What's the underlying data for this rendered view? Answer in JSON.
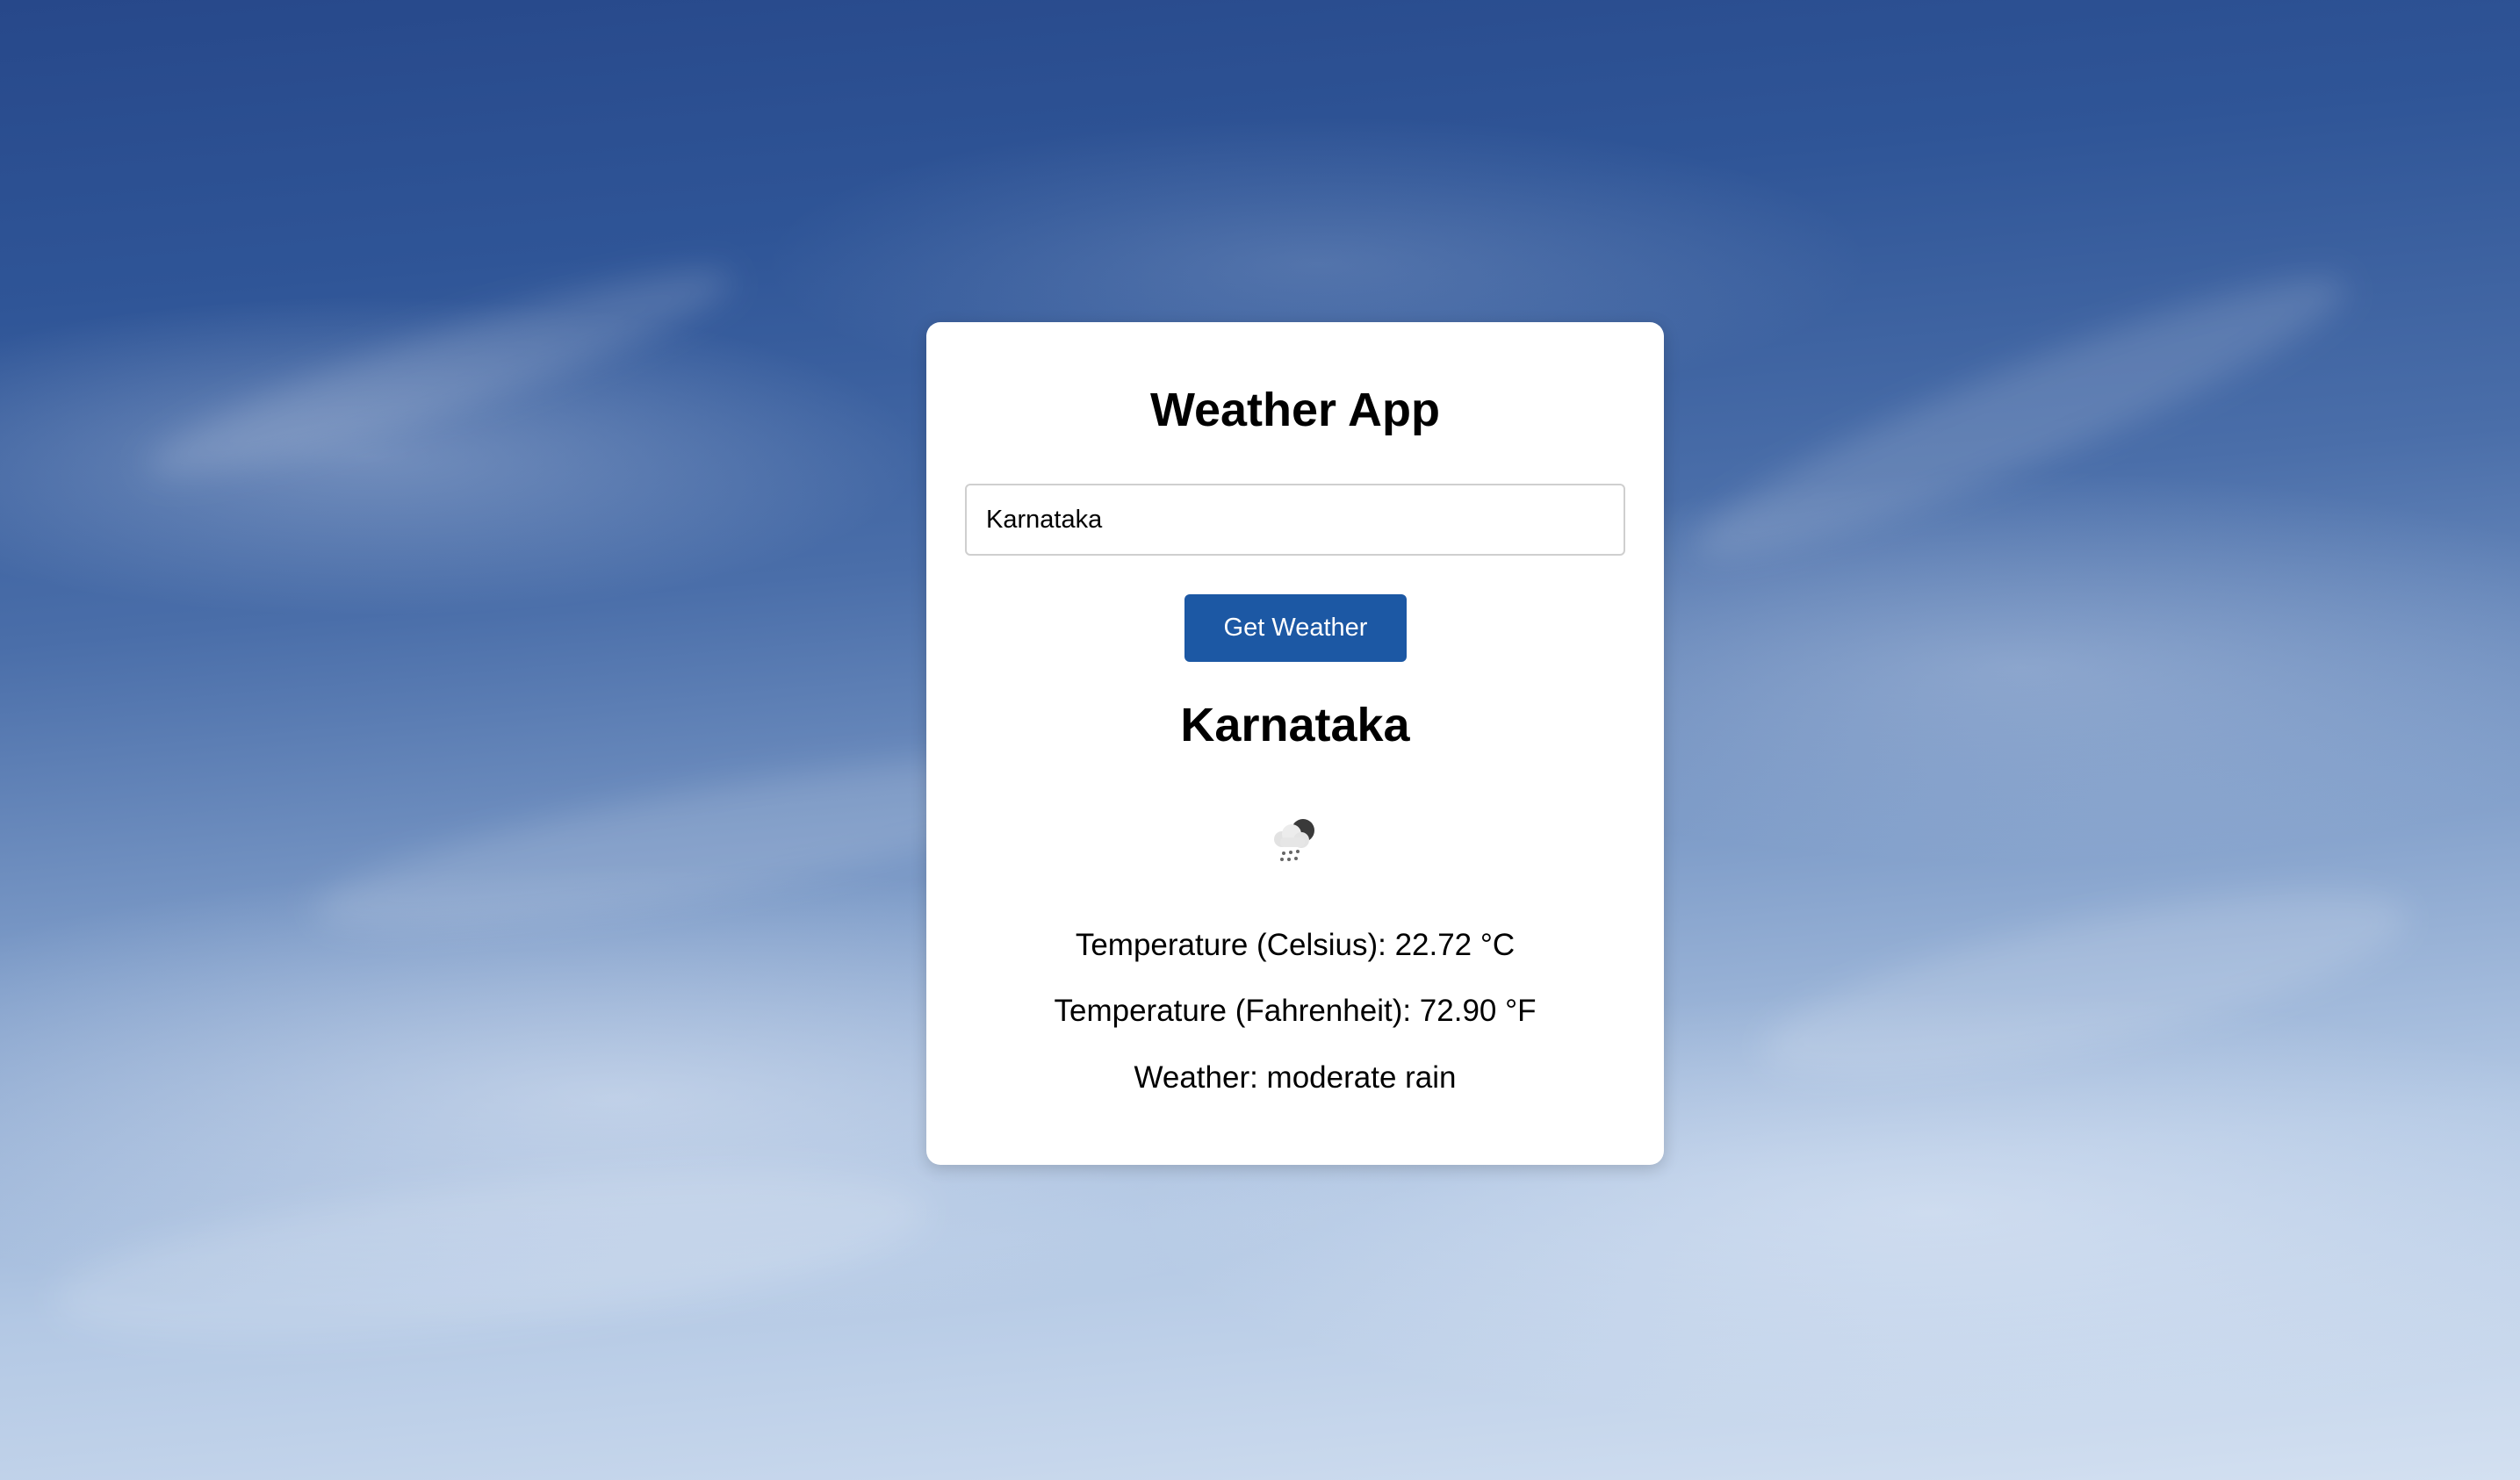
{
  "app": {
    "title": "Weather App"
  },
  "search": {
    "value": "Karnataka",
    "button_label": "Get Weather"
  },
  "result": {
    "location": "Karnataka",
    "icon": "moderate-rain-icon",
    "temperature_celsius": "Temperature (Celsius): 22.72 °C",
    "temperature_fahrenheit": "Temperature (Fahrenheit): 72.90 °F",
    "weather": "Weather: moderate rain"
  },
  "colors": {
    "button": "#1c58a4",
    "card": "#ffffff",
    "sky_top": "#27488a",
    "sky_bottom": "#d3e0f1"
  }
}
